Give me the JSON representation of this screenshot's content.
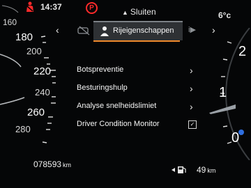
{
  "status": {
    "time": "14:37",
    "brake_symbol": "P",
    "close_label": "Sluiten",
    "temperature": "6°c",
    "seatbelt_icon": "seatbelt-warning-icon",
    "warning_color": "#ff2a2a"
  },
  "speedometer": {
    "ticks": [
      "160",
      "180",
      "200",
      "220",
      "240",
      "260",
      "280"
    ]
  },
  "tachometer": {
    "ticks": [
      "2",
      "1",
      "0"
    ]
  },
  "tabs": {
    "active_label": "Rijeigenschappen",
    "accent_color": "#f08a2c"
  },
  "menu": {
    "items": [
      {
        "label": "Botspreventie",
        "control": "chevron"
      },
      {
        "label": "Besturingshulp",
        "control": "chevron"
      },
      {
        "label": "Analyse snelheidslimiet",
        "control": "chevron"
      },
      {
        "label": "Driver Condition Monitor",
        "control": "checkbox",
        "check": "✓"
      }
    ]
  },
  "bottom": {
    "odometer_value": "078593",
    "odometer_unit": "km",
    "range_value": "49",
    "range_unit": "km"
  }
}
